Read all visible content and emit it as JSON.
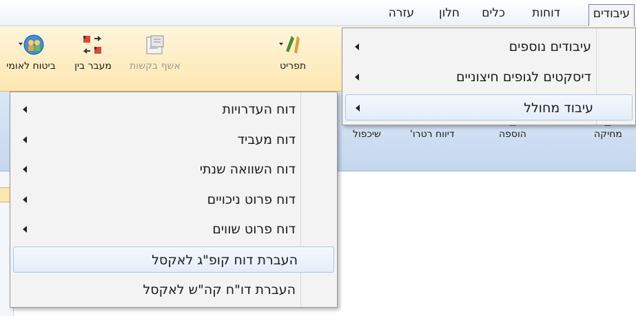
{
  "menubar": {
    "items": [
      {
        "label": "עיבודים",
        "open": true
      },
      {
        "label": "דוחות"
      },
      {
        "label": "כלים"
      },
      {
        "label": "חלון"
      },
      {
        "label": "עזרה"
      }
    ]
  },
  "toolbar": {
    "buttons": [
      {
        "label": "תפריט",
        "icon": "tools-icon"
      },
      {
        "label": "אשף בקשות",
        "icon": "wizard-form-icon",
        "disabled": true
      },
      {
        "label": "מעבר בין",
        "icon": "factory-transfer-icon"
      },
      {
        "label": "ביטוח לאומי",
        "icon": "globe-people-icon"
      }
    ]
  },
  "band": {
    "buttons": [
      {
        "label": "שיכפול",
        "icon": "duplicate-icon"
      },
      {
        "label": "דיווח רטרו'",
        "icon": "retro-report-icon"
      },
      {
        "label": "הוספה",
        "icon": "add-icon"
      },
      {
        "label": "מחיקה",
        "icon": "delete-icon"
      }
    ]
  },
  "processing_menu": {
    "items": [
      {
        "label": "עיבודים נוספים",
        "submenu": true
      },
      {
        "label": "דיסקטים לגופים חיצוניים",
        "submenu": true
      },
      {
        "label": "עיבוד מחולל",
        "submenu": true,
        "highlighted": true
      }
    ]
  },
  "generator_submenu": {
    "items": [
      {
        "label": "דוח העדרויות",
        "submenu": true
      },
      {
        "label": "דוח מעביד",
        "submenu": true
      },
      {
        "label": "דוח השוואה שנתי",
        "submenu": true
      },
      {
        "label": "דוח פרוט ניכויים",
        "submenu": true
      },
      {
        "label": "דוח פרוט שווים",
        "submenu": true
      },
      {
        "label": "העברת דוח קופ\"ג לאקסל",
        "submenu": false,
        "highlighted": true
      },
      {
        "label": "העברת דו\"ח קה\"ש לאקסל",
        "submenu": false
      }
    ]
  },
  "colors": {
    "menu_bg": "#f3f3f3",
    "highlight_border": "#a9c4e6",
    "toolbar_bg": "#fde7b0",
    "band_bg": "#c5d7ee"
  }
}
